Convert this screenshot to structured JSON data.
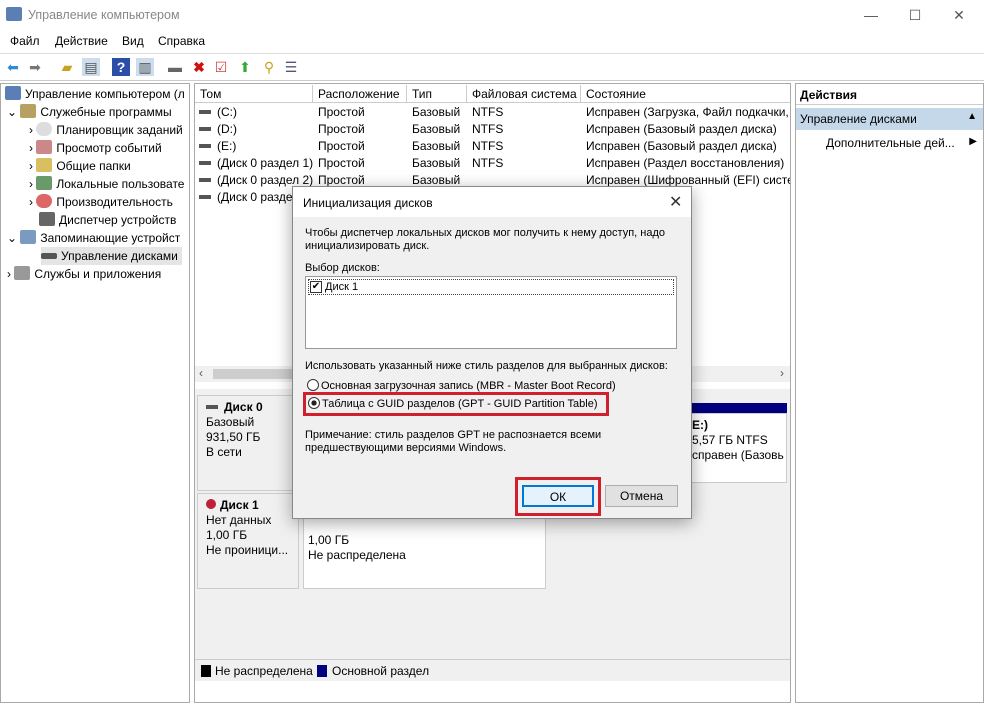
{
  "window": {
    "title": "Управление компьютером",
    "minimize": "—",
    "maximize": "☐",
    "close": "✕"
  },
  "menu": [
    "Файл",
    "Действие",
    "Вид",
    "Справка"
  ],
  "toolbar": [
    "back-icon",
    "forward-icon",
    "up-folder-icon",
    "show-hide-tree-icon",
    "help-icon",
    "show-hide-action-icon",
    "connect-icon",
    "delete-icon",
    "properties-icon",
    "refresh-icon",
    "search-icon",
    "list-icon"
  ],
  "tree": {
    "root": "Управление компьютером (л",
    "items": [
      {
        "label": "Служебные программы",
        "level": 1,
        "expanded": true
      },
      {
        "label": "Планировщик заданий",
        "level": 2
      },
      {
        "label": "Просмотр событий",
        "level": 2
      },
      {
        "label": "Общие папки",
        "level": 2
      },
      {
        "label": "Локальные пользовате",
        "level": 2
      },
      {
        "label": "Производительность",
        "level": 2
      },
      {
        "label": "Диспетчер устройств",
        "level": 2
      },
      {
        "label": "Запоминающие устройст",
        "level": 1,
        "expanded": true
      },
      {
        "label": "Управление дисками",
        "level": 2,
        "selected": true
      },
      {
        "label": "Службы и приложения",
        "level": 1
      }
    ]
  },
  "table": {
    "columns": [
      "Том",
      "Расположение",
      "Тип",
      "Файловая система",
      "Состояние"
    ],
    "rows": [
      [
        "(C:)",
        "Простой",
        "Базовый",
        "NTFS",
        "Исправен (Загрузка, Файл подкачки,"
      ],
      [
        "(D:)",
        "Простой",
        "Базовый",
        "NTFS",
        "Исправен (Базовый раздел диска)"
      ],
      [
        "(E:)",
        "Простой",
        "Базовый",
        "NTFS",
        "Исправен (Базовый раздел диска)"
      ],
      [
        "(Диск 0 раздел 1)",
        "Простой",
        "Базовый",
        "NTFS",
        "Исправен (Раздел восстановления)"
      ],
      [
        "(Диск 0 раздел 2)",
        "Простой",
        "Базовый",
        "",
        "Исправен (Шифрованный (EFI) систе"
      ],
      [
        "(Диск 0 раздел",
        "",
        "",
        "",
        "осстановления)"
      ]
    ]
  },
  "disks": [
    {
      "name": "Диск 0",
      "type": "Базовый",
      "size": "931,50 ГБ",
      "status": "В сети",
      "partition": {
        "name": "E:)",
        "size": "5,57 ГБ NTFS",
        "status": "справен (Базовь"
      }
    },
    {
      "name": "Диск 1",
      "type": "Нет данных",
      "size": "1,00 ГБ",
      "status": "Не проиници...",
      "partition": {
        "size": "1,00 ГБ",
        "status": "Не распределена"
      }
    }
  ],
  "legend": [
    {
      "label": "Не распределена",
      "color": "#000000"
    },
    {
      "label": "Основной раздел",
      "color": "#000080"
    }
  ],
  "actions": {
    "header": "Действия",
    "section": "Управление дисками",
    "item": "Дополнительные дей..."
  },
  "dialog": {
    "title": "Инициализация дисков",
    "intro": "Чтобы диспетчер локальных дисков мог получить к нему доступ, надо инициализировать диск.",
    "select_label": "Выбор дисков:",
    "disks": [
      {
        "label": "Диск 1",
        "checked": true
      }
    ],
    "style_label": "Использовать указанный ниже стиль разделов для выбранных дисков:",
    "options": [
      {
        "label": "Основная загрузочная запись (MBR - Master Boot Record)",
        "selected": false
      },
      {
        "label": "Таблица с GUID разделов (GPT - GUID Partition Table)",
        "selected": true
      }
    ],
    "note": "Примечание: стиль разделов GPT не распознается всеми предшествующими версиями Windows.",
    "ok": "ОК",
    "cancel": "Отмена"
  },
  "colors": {
    "highlight": "#d0202e",
    "selected_action": "#c5d8ea",
    "primary_partition": "#000080"
  }
}
